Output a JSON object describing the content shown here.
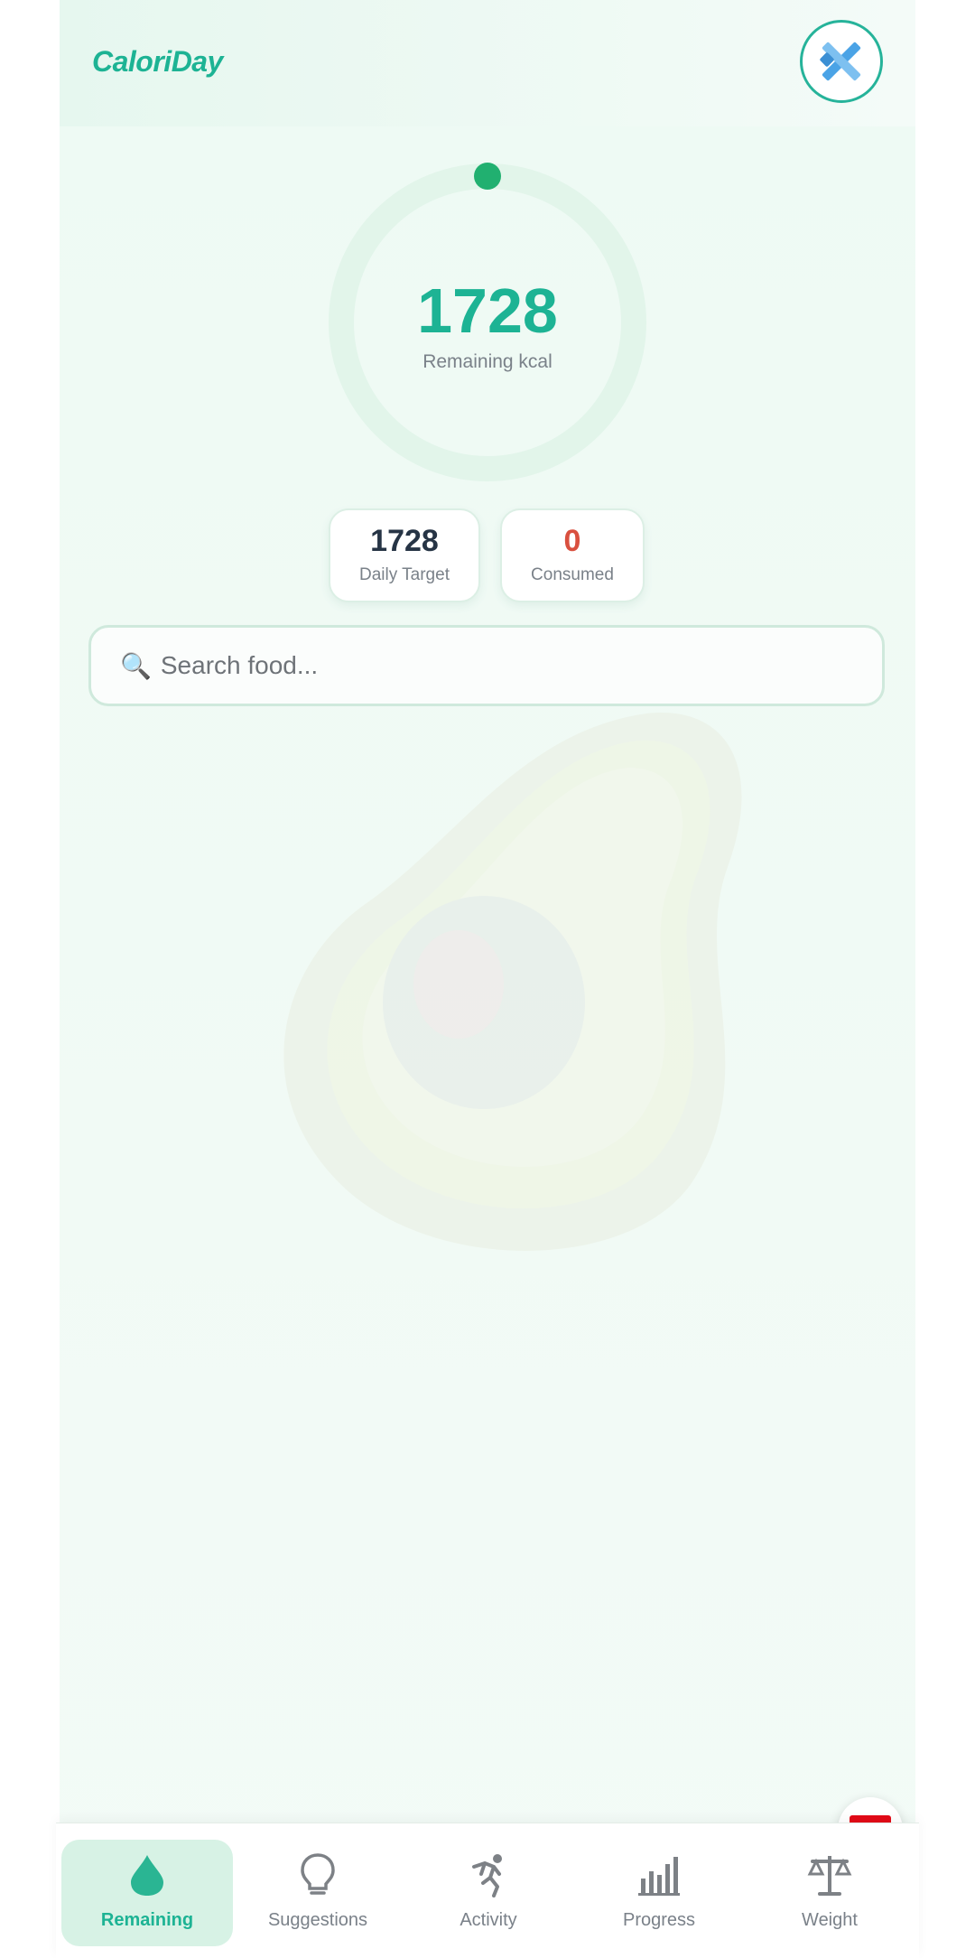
{
  "app": {
    "name": "CaloriDay"
  },
  "header": {
    "avatar_icon": "crossed-tools-icon"
  },
  "summary": {
    "remaining_value": "1728",
    "remaining_label": "Remaining kcal",
    "consumed_fraction": 0,
    "daily_target_value": "1728",
    "daily_target_label": "Daily Target",
    "consumed_value": "0",
    "consumed_label": "Consumed"
  },
  "search": {
    "icon": "🔍",
    "placeholder": "Search food..."
  },
  "language": {
    "flag": "turkey-flag-icon"
  },
  "tabs": [
    {
      "label": "Remaining",
      "icon": "drop-icon",
      "active": true
    },
    {
      "label": "Suggestions",
      "icon": "lightbulb-icon",
      "active": false
    },
    {
      "label": "Activity",
      "icon": "running-figure-icon",
      "active": false
    },
    {
      "label": "Progress",
      "icon": "bar-chart-icon",
      "active": false
    },
    {
      "label": "Weight",
      "icon": "scale-icon",
      "active": false
    }
  ],
  "colors": {
    "accent": "#1db394",
    "consumed": "#d9503f",
    "dark_text": "#263445",
    "muted_text": "#7a8189"
  }
}
